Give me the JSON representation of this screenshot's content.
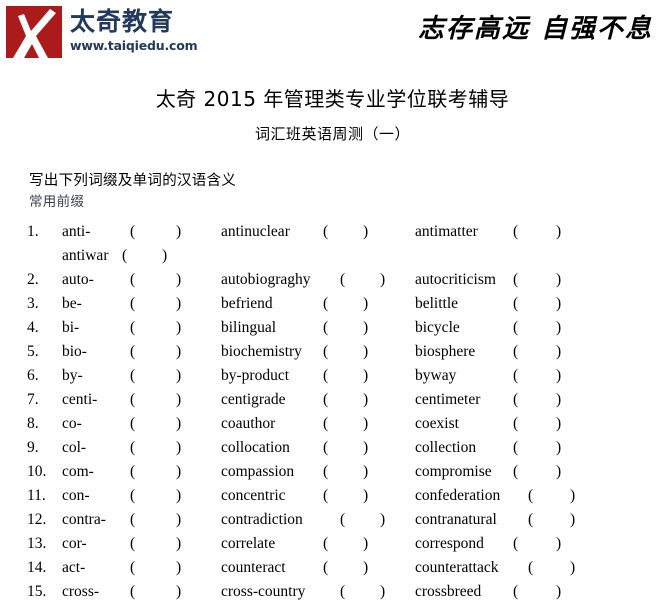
{
  "header": {
    "logo_mark_color": "#ab1b1b",
    "brand_name": "太奇教育",
    "brand_url": "www.taiqiedu.com",
    "brand_text_color": "#21395c",
    "slogan": "志存高远 自强不息"
  },
  "document": {
    "title": "太奇 2015 年管理类专业学位联考辅导",
    "subtitle": "词汇班英语周测（一）",
    "instruction": "写出下列词缀及单词的汉语含义",
    "section_label": "常用前缀",
    "blank_open": "(",
    "blank_close": ")"
  },
  "exercises": [
    {
      "num": "1.",
      "affix": "anti-",
      "word1": "antinuclear",
      "word2": "antimatter",
      "continuation": {
        "word": "antiwar"
      }
    },
    {
      "num": "2.",
      "affix": "auto-",
      "word1": "autobiograghy",
      "word2": "autocriticism",
      "tight1": true
    },
    {
      "num": "3.",
      "affix": "be-",
      "word1": "befriend",
      "word2": "belittle"
    },
    {
      "num": "4.",
      "affix": "bi-",
      "word1": "bilingual",
      "word2": "bicycle"
    },
    {
      "num": "5.",
      "affix": "bio-",
      "word1": "biochemistry",
      "word2": "biosphere"
    },
    {
      "num": "6.",
      "affix": "by-",
      "word1": "by-product",
      "word2": "byway"
    },
    {
      "num": "7.",
      "affix": "centi-",
      "word1": "centigrade",
      "word2": "centimeter"
    },
    {
      "num": "8.",
      "affix": "co-",
      "word1": "coauthor",
      "word2": "coexist"
    },
    {
      "num": "9.",
      "affix": "col-",
      "word1": "collocation",
      "word2": "collection"
    },
    {
      "num": "10.",
      "affix": "com-",
      "word1": "compassion",
      "word2": "compromise"
    },
    {
      "num": "11.",
      "affix": "con-",
      "word1": "concentric",
      "word2": "confederation",
      "tight2": true
    },
    {
      "num": "12.",
      "affix": "contra-",
      "word1": "contradiction",
      "word2": "contranatural",
      "tight1": true,
      "tight2": true
    },
    {
      "num": "13.",
      "affix": "cor-",
      "word1": "correlate",
      "word2": "correspond"
    },
    {
      "num": "14.",
      "affix": "act-",
      "word1": "counteract",
      "word2": " counterattack",
      "tight2": true
    },
    {
      "num": "15.",
      "affix": "cross-",
      "word1": "cross-country",
      "word2": " crossbreed",
      "tight1": true
    }
  ]
}
